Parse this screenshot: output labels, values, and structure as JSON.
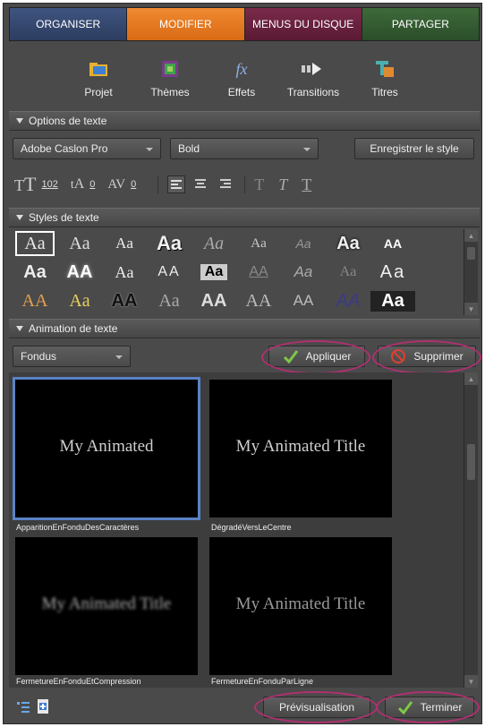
{
  "tabs": [
    "ORGANISER",
    "MODIFIER",
    "MENUS DU DISQUE",
    "PARTAGER"
  ],
  "toolbar": [
    "Projet",
    "Thèmes",
    "Effets",
    "Transitions",
    "Titres"
  ],
  "options": {
    "header": "Options de texte",
    "font": "Adobe Caslon Pro",
    "weight": "Bold",
    "save_style": "Enregistrer le style",
    "size": "102",
    "leading": "0",
    "kerning": "0"
  },
  "styles": {
    "header": "Styles de texte",
    "rows": [
      [
        "Aa",
        "Aa",
        "Aa",
        "Aa",
        "Aa",
        "Aa",
        "Aa",
        "Aa",
        "AA"
      ],
      [
        "Aa",
        "AA",
        "Aa",
        "AA",
        "Aa",
        "AA",
        "Aa",
        "Aa",
        "Aa"
      ],
      [
        "AA",
        "Aa",
        "AA",
        "Aa",
        "AA",
        "AA",
        "AA",
        "AA",
        "Aa"
      ]
    ]
  },
  "animation": {
    "header": "Animation de texte",
    "filter": "Fondus",
    "apply": "Appliquer",
    "delete": "Supprimer",
    "items": [
      {
        "preview": "My Animated",
        "caption": "ApparitionEnFonduDesCaractères"
      },
      {
        "preview": "My Animated Title",
        "caption": "DégradéVersLeCentre"
      },
      {
        "preview": "My Animated Title",
        "caption": "FermetureEnFonduEtCompression"
      },
      {
        "preview": "My Animated Title",
        "caption": "FermetureEnFonduParLigne"
      }
    ]
  },
  "footer": {
    "preview": "Prévisualisation",
    "done": "Terminer"
  },
  "colors": {
    "accent_tab": "#e07a20",
    "highlight_oval": "#b03070",
    "selection": "#5a82c6",
    "check_green": "#7ec846"
  }
}
